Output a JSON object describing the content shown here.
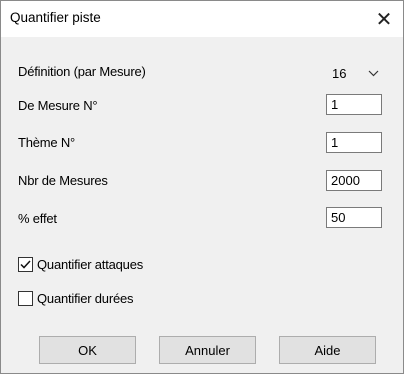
{
  "window": {
    "title": "Quantifier piste",
    "close_glyph": "✕"
  },
  "form": {
    "definition": {
      "label": "Définition (par Mesure)",
      "value": "16"
    },
    "de_mesure": {
      "label": "De Mesure N°",
      "value": "1"
    },
    "theme": {
      "label": "Thème N°",
      "value": "1"
    },
    "nbr_mesures": {
      "label": "Nbr de Mesures",
      "value": "2000"
    },
    "effet": {
      "label": "% effet",
      "value": "50"
    }
  },
  "options": {
    "attaques": {
      "label": "Quantifier attaques",
      "checked": true
    },
    "durees": {
      "label": "Quantifier durées",
      "checked": false
    }
  },
  "buttons": {
    "ok": "OK",
    "annuler": "Annuler",
    "aide": "Aide"
  }
}
